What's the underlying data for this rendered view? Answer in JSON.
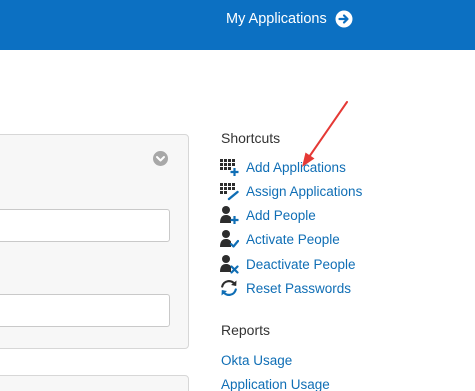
{
  "header": {
    "my_applications_label": "My Applications",
    "my_applications_icon": "arrow-right-circle-icon",
    "bar_color": "#0c70c2"
  },
  "form_panel": {
    "toggle_icon": "chevron-down-icon",
    "field_1_value": "",
    "field_2_value": ""
  },
  "shortcuts": {
    "title": "Shortcuts",
    "items": [
      {
        "label": "Add Applications",
        "icon": "add-applications-icon"
      },
      {
        "label": "Assign Applications",
        "icon": "assign-applications-icon"
      },
      {
        "label": "Add People",
        "icon": "add-person-icon"
      },
      {
        "label": "Activate People",
        "icon": "activate-person-icon"
      },
      {
        "label": "Deactivate People",
        "icon": "deactivate-person-icon"
      },
      {
        "label": "Reset Passwords",
        "icon": "reset-refresh-icon"
      }
    ]
  },
  "reports": {
    "title": "Reports",
    "items": [
      {
        "label": "Okta Usage"
      },
      {
        "label": "Application Usage"
      }
    ]
  },
  "annotation": {
    "arrow_color": "#e53935",
    "points_to": "Add Applications"
  },
  "colors": {
    "link": "#0f6eb5",
    "icon": "#2d2d2d",
    "icon_accent": "#0f6eb5"
  }
}
